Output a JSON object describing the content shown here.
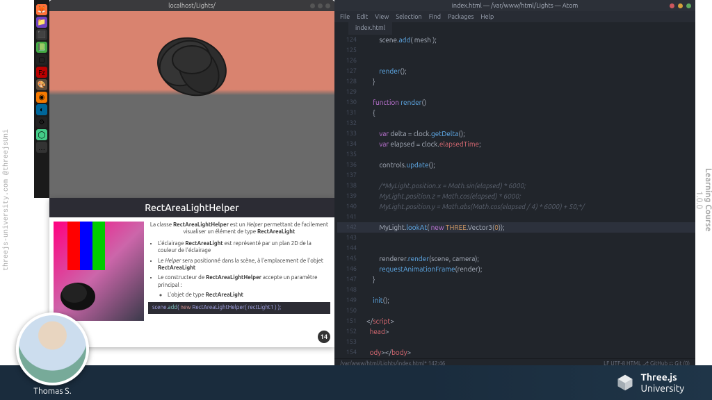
{
  "sidebar": {
    "left": "threejs-university.com @threejsUni",
    "right_line1": "Learning Course",
    "right_line2": "1.0.0"
  },
  "dock": {
    "icons": [
      "firefox",
      "files",
      "edge",
      "folder",
      "terminal",
      "vscode",
      "filezilla",
      "gimp",
      "blender",
      "email",
      "discord"
    ]
  },
  "browser": {
    "title": "localhost/Lights/"
  },
  "slide": {
    "title": "RectAreaLightHelper",
    "desc_a": "La classe ",
    "desc_bold1": "RectAreaLightHelper",
    "desc_b": " est un ",
    "desc_it": "Helper",
    "desc_c": " permettant de facilement visualiser un élément de type ",
    "desc_bold2": "RectAreaLight",
    "b1a": "L'éclairage ",
    "b1bold": "RectAreaLight",
    "b1b": " est représenté par un plan 2D de la couleur de l'éclairage",
    "b2a": "Le ",
    "b2it": "Helper",
    "b2b": " sera positionné dans la scène, à l'emplacement de l'objet ",
    "b2bold": "RectAreaLight",
    "b3a": "Le constructeur de ",
    "b3bold": "RectAreaLightHelper",
    "b3b": " accepte un paramètre principal :",
    "b4a": "L'objet de type ",
    "b4bold": "RectAreaLight",
    "code": {
      "a": "scene.",
      "b": "add",
      "c": "( ",
      "d": "new",
      "e": " RectAreaLightHelper( rectLight1 ) );"
    },
    "page": "14"
  },
  "editor": {
    "title": "index.html — /var/www/html/Lights — Atom",
    "menu": [
      "File",
      "Edit",
      "View",
      "Selection",
      "Find",
      "Packages",
      "Help"
    ],
    "tab": "index.html",
    "status_left": "/var/www/html/Lights/index.html*    142:46",
    "status_right": "LF   UTF-8   HTML   ⎇ GitHub   ⎌ Git (0)",
    "lines": [
      {
        "n": "124",
        "t": [
          [
            "",
            "        scene."
          ],
          [
            "fn",
            "add"
          ],
          [
            "",
            "( mesh );"
          ]
        ]
      },
      {
        "n": "125",
        "t": [
          [
            "",
            ""
          ]
        ]
      },
      {
        "n": "126",
        "t": [
          [
            "",
            ""
          ]
        ]
      },
      {
        "n": "127",
        "t": [
          [
            "",
            "        "
          ],
          [
            "fn",
            "render"
          ],
          [
            "",
            "();"
          ]
        ]
      },
      {
        "n": "128",
        "t": [
          [
            "",
            "    }"
          ]
        ]
      },
      {
        "n": "129",
        "t": [
          [
            "",
            ""
          ]
        ]
      },
      {
        "n": "130",
        "t": [
          [
            "",
            "    "
          ],
          [
            "kw",
            "function"
          ],
          [
            "",
            " "
          ],
          [
            "fn",
            "render"
          ],
          [
            "",
            "()"
          ]
        ]
      },
      {
        "n": "131",
        "t": [
          [
            "",
            "    {"
          ]
        ]
      },
      {
        "n": "132",
        "t": [
          [
            "",
            ""
          ]
        ]
      },
      {
        "n": "133",
        "t": [
          [
            "",
            "        "
          ],
          [
            "kw",
            "var"
          ],
          [
            "",
            " delta "
          ],
          [
            "op",
            "="
          ],
          [
            "",
            " clock."
          ],
          [
            "fn",
            "getDelta"
          ],
          [
            "",
            "();"
          ]
        ]
      },
      {
        "n": "134",
        "t": [
          [
            "",
            "        "
          ],
          [
            "kw",
            "var"
          ],
          [
            "",
            " elapsed "
          ],
          [
            "op",
            "="
          ],
          [
            "",
            " clock."
          ],
          [
            "id",
            "elapsedTime"
          ],
          [
            "",
            ";"
          ]
        ]
      },
      {
        "n": "135",
        "t": [
          [
            "",
            ""
          ]
        ]
      },
      {
        "n": "136",
        "t": [
          [
            "",
            "        controls."
          ],
          [
            "fn",
            "update"
          ],
          [
            "",
            "();"
          ]
        ]
      },
      {
        "n": "137",
        "t": [
          [
            "",
            ""
          ]
        ]
      },
      {
        "n": "138",
        "t": [
          [
            "cm",
            "        /*MyLight.position.x = Math.sin(elapsed) * 6000;"
          ]
        ]
      },
      {
        "n": "139",
        "t": [
          [
            "cm",
            "        MyLight.position.z = Math.cos(elapsed) * 6000;"
          ]
        ]
      },
      {
        "n": "140",
        "t": [
          [
            "cm",
            "        MyLight.position.y = Math.abs(Math.cos(elapsed / 4) * 6000) + 50;*/"
          ]
        ]
      },
      {
        "n": "141",
        "t": [
          [
            "",
            ""
          ]
        ]
      },
      {
        "n": "142",
        "hl": true,
        "t": [
          [
            "",
            "        MyLight."
          ],
          [
            "fn",
            "lookAt"
          ],
          [
            "",
            "( "
          ],
          [
            "kw",
            "new"
          ],
          [
            "",
            " "
          ],
          [
            "re",
            "THREE"
          ],
          [
            "",
            ".Vector3("
          ],
          [
            "nm",
            "0"
          ],
          [
            "",
            "));"
          ]
        ]
      },
      {
        "n": "143",
        "t": [
          [
            "",
            ""
          ]
        ]
      },
      {
        "n": "144",
        "t": [
          [
            "",
            ""
          ]
        ]
      },
      {
        "n": "145",
        "t": [
          [
            "",
            "        renderer."
          ],
          [
            "fn",
            "render"
          ],
          [
            "",
            "(scene, camera);"
          ]
        ]
      },
      {
        "n": "146",
        "t": [
          [
            "",
            "        "
          ],
          [
            "fn",
            "requestAnimationFrame"
          ],
          [
            "",
            "(render);"
          ]
        ]
      },
      {
        "n": "147",
        "t": [
          [
            "",
            "    }"
          ]
        ]
      },
      {
        "n": "148",
        "t": [
          [
            "",
            ""
          ]
        ]
      },
      {
        "n": "149",
        "t": [
          [
            "",
            "    "
          ],
          [
            "fn",
            "init"
          ],
          [
            "",
            "();"
          ]
        ]
      },
      {
        "n": "150",
        "t": [
          [
            "",
            ""
          ]
        ]
      },
      {
        "n": "151",
        "t": [
          [
            "",
            "</"
          ],
          [
            "tag",
            "script"
          ],
          [
            "",
            ">"
          ]
        ]
      },
      {
        "n": "152",
        "t": [
          [
            "tag",
            "  head"
          ],
          [
            "",
            ">"
          ]
        ]
      },
      {
        "n": "153",
        "t": [
          [
            "",
            ""
          ]
        ]
      },
      {
        "n": "154",
        "t": [
          [
            "tag",
            "  ody"
          ],
          [
            "",
            "></"
          ],
          [
            "tag",
            "body"
          ],
          [
            "",
            ">"
          ]
        ]
      }
    ]
  },
  "banner": {
    "name1": "Three.js",
    "name2": "University"
  },
  "avatar": {
    "name": "Thomas S."
  }
}
